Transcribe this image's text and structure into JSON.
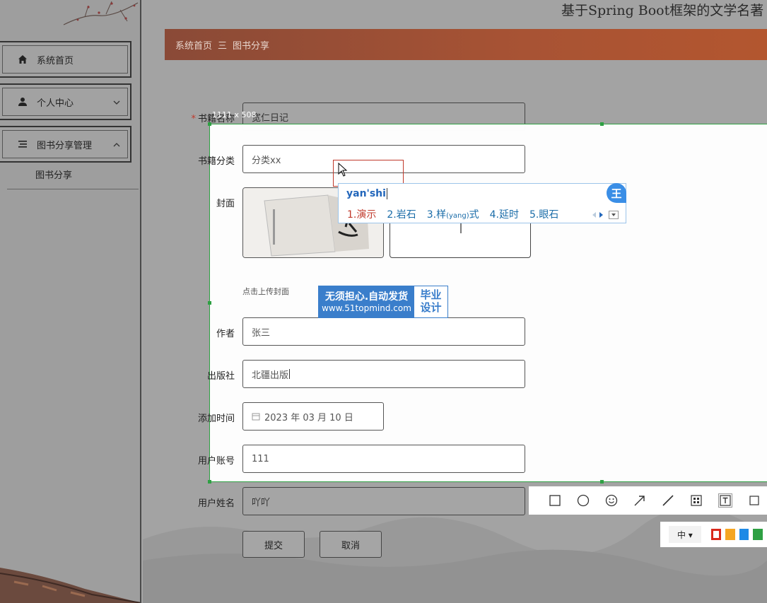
{
  "sidebar": {
    "items": [
      {
        "label": "系统首页",
        "icon": "home-icon"
      },
      {
        "label": "个人中心",
        "icon": "user-icon"
      },
      {
        "label": "图书分享管理",
        "icon": "list-icon"
      }
    ],
    "submenu": {
      "label": "图书分享"
    }
  },
  "header": {
    "site_title": "基于Spring Boot框架的文学名著",
    "breadcrumb": {
      "home": "系统首页",
      "separator": "三",
      "current": "图书分享"
    }
  },
  "selection": {
    "size_label": "1111 x 508"
  },
  "form": {
    "book_name": {
      "label": "书籍名称",
      "value": "宽仁日记"
    },
    "category": {
      "label": "书籍分类",
      "value": "分类xx"
    },
    "cover": {
      "label": "封面",
      "upload_hint": "点击上传封面"
    },
    "author": {
      "label": "作者",
      "value": "张三"
    },
    "publisher": {
      "label": "出版社",
      "value": "北疆出版"
    },
    "add_time": {
      "label": "添加时间",
      "value": "2023 年 03 月 10 日"
    },
    "user_account": {
      "label": "用户账号",
      "value": "111"
    },
    "user_name": {
      "label": "用户姓名",
      "value": "吖吖"
    },
    "submit_label": "提交",
    "cancel_label": "取消"
  },
  "ime": {
    "pinyin": "yan'shi",
    "candidates": [
      {
        "label": "1.演示"
      },
      {
        "label": "2.岩石"
      },
      {
        "label": "3.样"
      },
      {
        "label": "4.延时"
      },
      {
        "label": "5.眼石"
      }
    ],
    "candidate3_pinyin": "(yang)",
    "candidate3_suffix": "式",
    "logo": "王"
  },
  "watermark": {
    "line1": "无须担心.自动发货",
    "line2": "www.51topmind.com",
    "right_line1": "毕业",
    "right_line2": "设计"
  },
  "toolbar": {
    "size_label": "中 ▾",
    "colors": [
      "#d9291c",
      "#f5a623",
      "#1e8ae6",
      "#2ea043"
    ]
  },
  "colors": {
    "selection_border": "#2ea043",
    "breadcrumb_bg": "#a85334"
  }
}
